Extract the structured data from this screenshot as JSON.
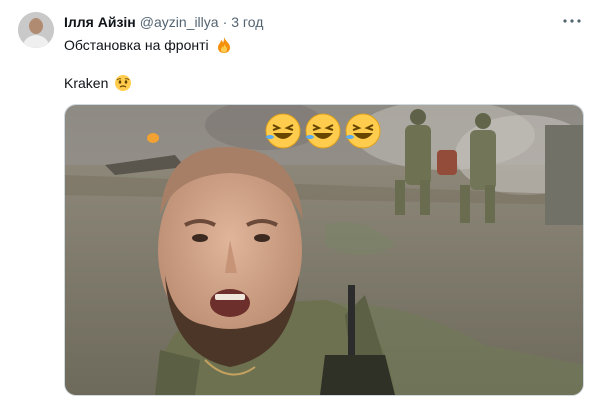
{
  "tweet": {
    "author_name": "Ілля Айзін",
    "author_handle": "@ayzin_illya",
    "separator": "·",
    "time": "3 год",
    "text_line1": "Обстановка на фронті",
    "text_line2": "Kraken"
  },
  "icons": {
    "more": "more-dots-icon",
    "fire": "fire-emoji",
    "face": "face-holding-back-tears-emoji",
    "laughing": "rolling-on-floor-laughing-emoji"
  },
  "media": {
    "overlay_emojis": [
      "rolling-on-floor-laughing-emoji",
      "rolling-on-floor-laughing-emoji",
      "rolling-on-floor-laughing-emoji"
    ]
  },
  "colors": {
    "text_primary": "#0f1419",
    "text_secondary": "#536471",
    "border": "#cfd9de"
  }
}
